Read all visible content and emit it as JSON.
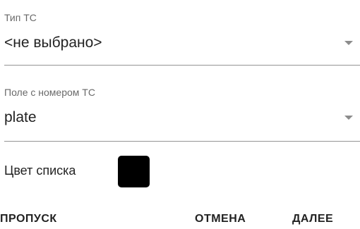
{
  "fields": {
    "vehicle_type": {
      "label": "Тип ТС",
      "value": "<не выбрано>",
      "icon": "dropdown-arrow-icon"
    },
    "plate_field": {
      "label": "Поле с номером ТС",
      "value": "plate",
      "icon": "dropdown-arrow-icon"
    }
  },
  "list_color": {
    "label": "Цвет списка",
    "color": "#000000"
  },
  "actions": {
    "skip_label": "ПРОПУСК",
    "cancel_label": "ОТМЕНА",
    "next_label": "ДАЛЕЕ"
  }
}
